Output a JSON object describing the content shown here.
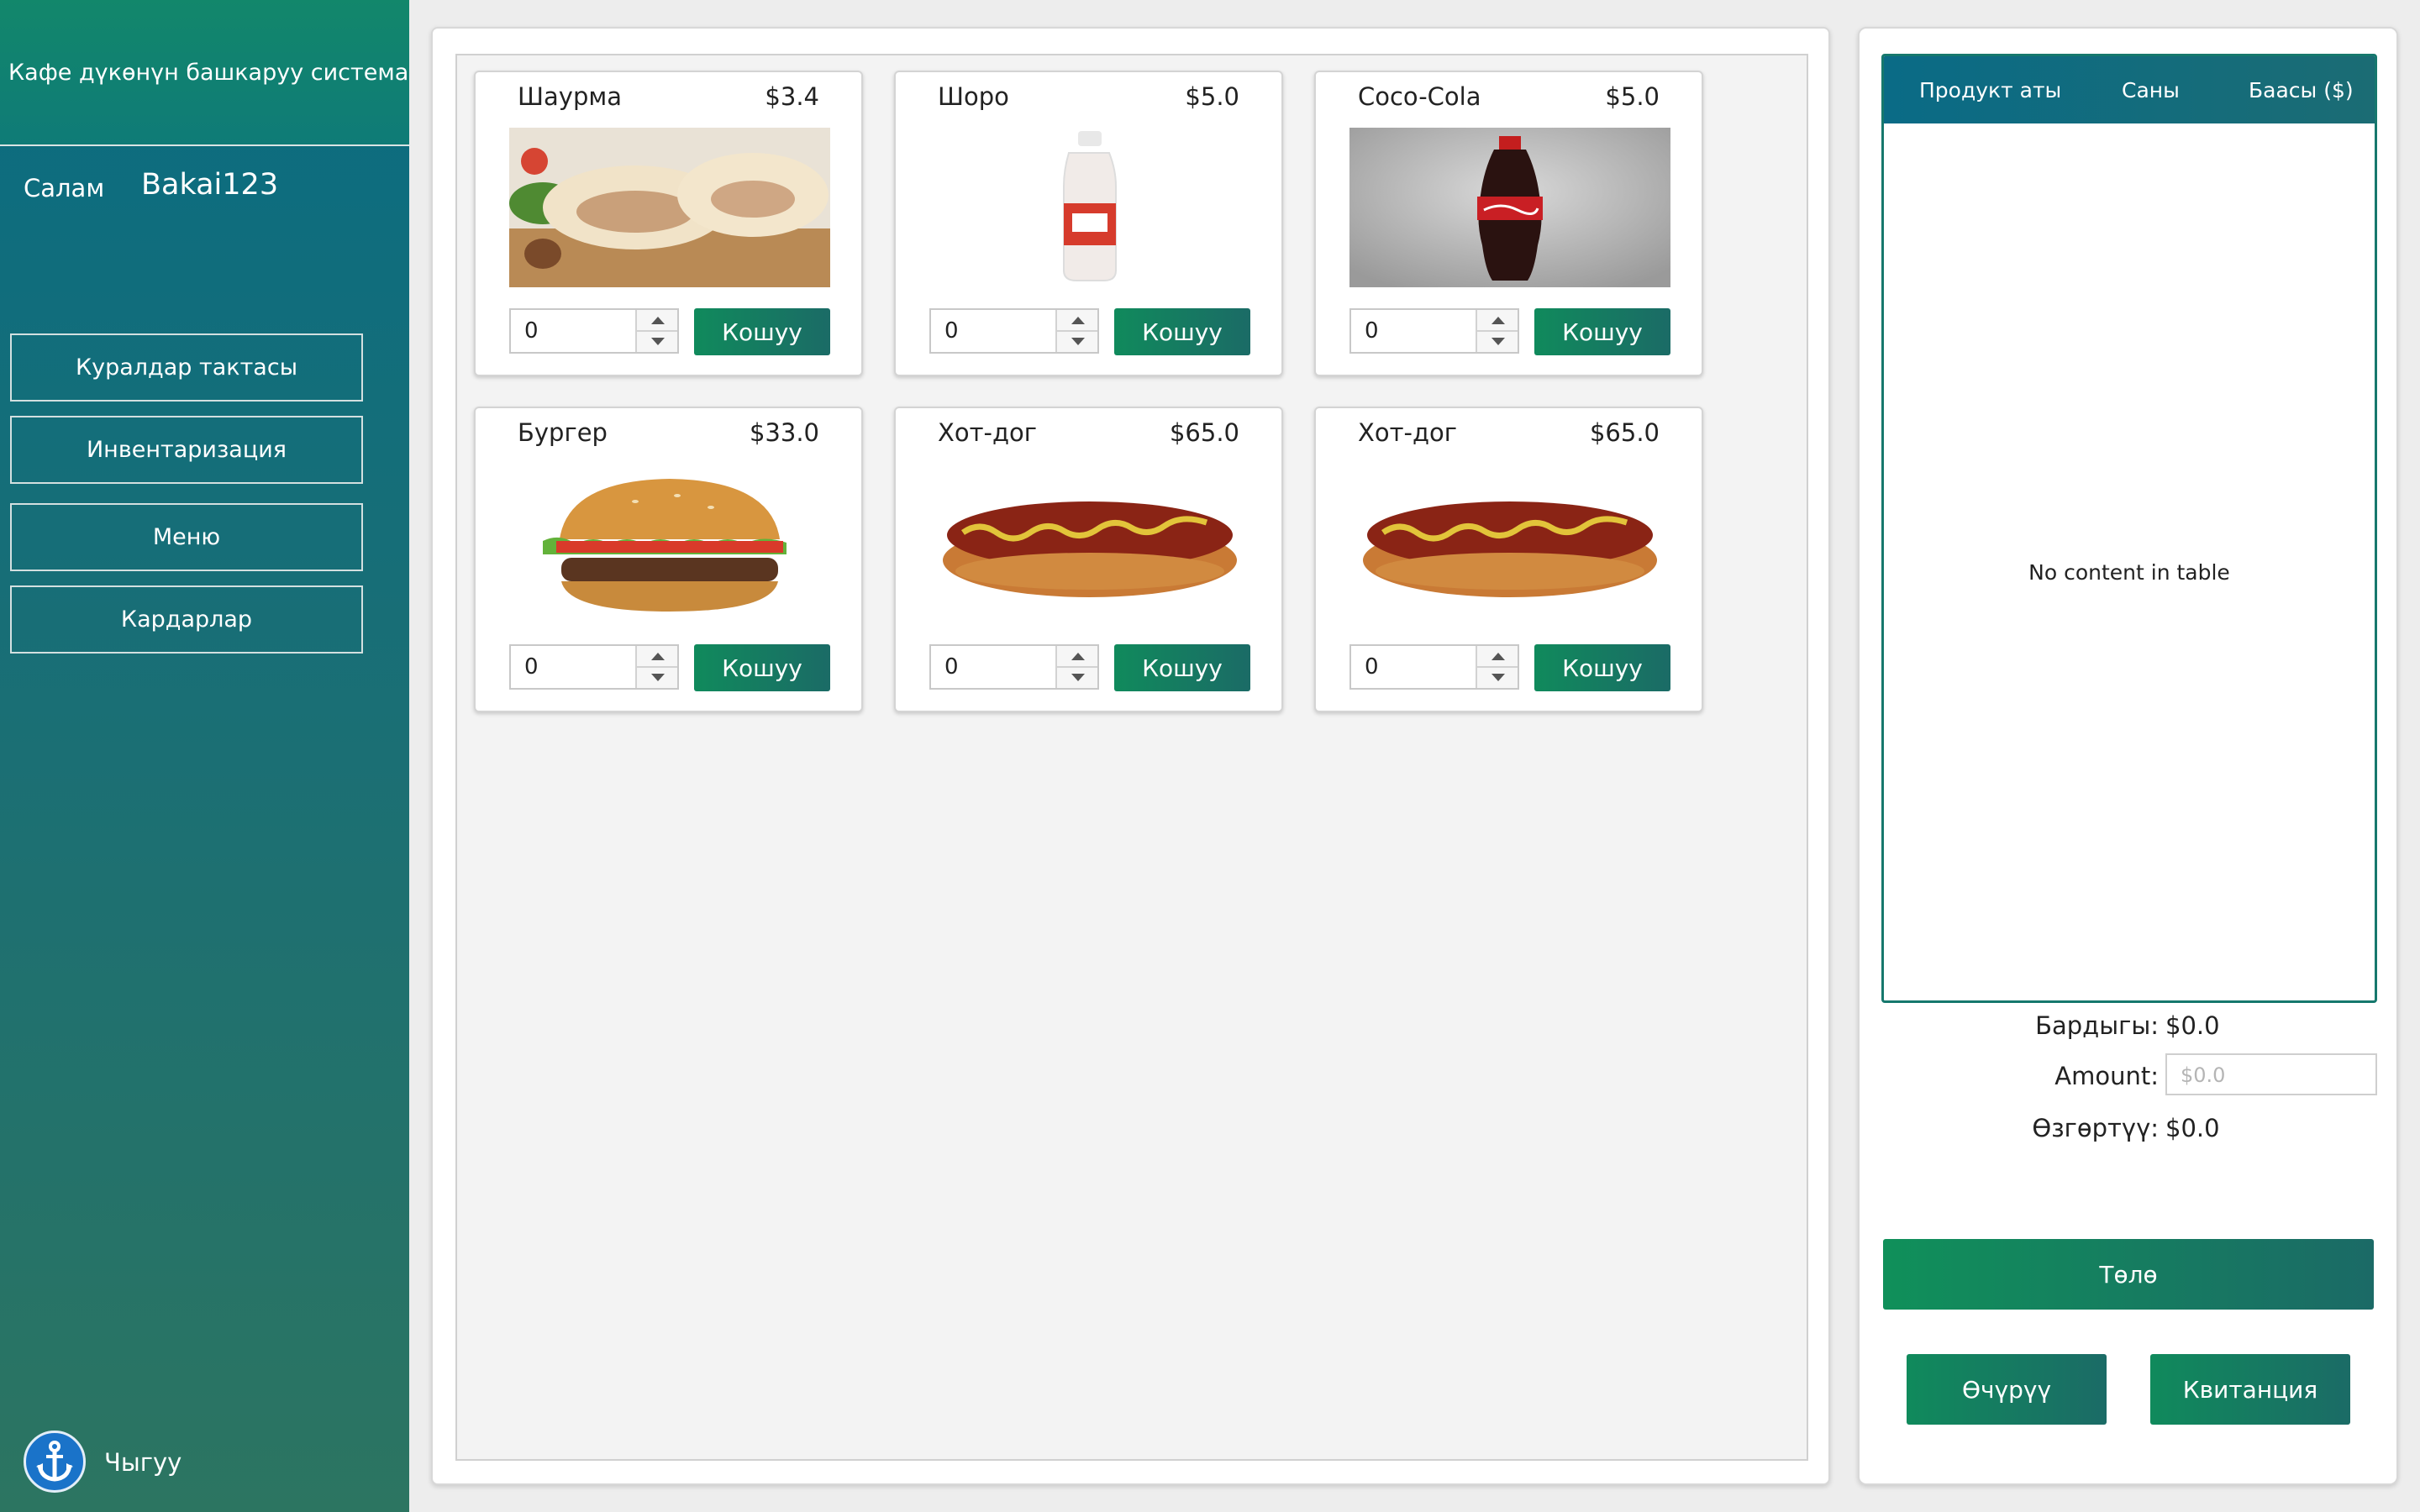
{
  "app": {
    "title": "Кафе дүкөнүн башкаруу системасы"
  },
  "user": {
    "greeting": "Салам",
    "name": "Bakai123"
  },
  "nav": [
    {
      "label": "Куралдар тактасы"
    },
    {
      "label": "Инвентаризация"
    },
    {
      "label": "Меню"
    },
    {
      "label": "Кардарлар"
    }
  ],
  "logout": {
    "label": "Чыгуу",
    "icon": "anchor-icon"
  },
  "menu_items": [
    {
      "name": "Шаурма",
      "price": "$3.4",
      "qty": "0",
      "add_label": "Кошуу",
      "image": "shawarma"
    },
    {
      "name": "Шоро",
      "price": "$5.0",
      "qty": "0",
      "add_label": "Кошуу",
      "image": "shoro-bottle"
    },
    {
      "name": "Coco-Cola",
      "price": "$5.0",
      "qty": "0",
      "add_label": "Кошуу",
      "image": "cola-bottle"
    },
    {
      "name": "Бургер",
      "price": "$33.0",
      "qty": "0",
      "add_label": "Кошуу",
      "image": "burger"
    },
    {
      "name": "Хот-дог",
      "price": "$65.0",
      "qty": "0",
      "add_label": "Кошуу",
      "image": "hotdog"
    },
    {
      "name": "Хот-дог",
      "price": "$65.0",
      "qty": "0",
      "add_label": "Кошуу",
      "image": "hotdog"
    }
  ],
  "order": {
    "columns": [
      "Продукт аты",
      "Саны",
      "Баасы ($)"
    ],
    "empty_text": "No content in table",
    "total_label": "Бардыгы:",
    "total_value": "$0.0",
    "amount_label": "Amount:",
    "amount_placeholder": "$0.0",
    "change_label": "Өзгөртүү:",
    "change_value": "$0.0",
    "pay_label": "Төлө",
    "delete_label": "Өчүрүү",
    "receipt_label": "Квитанция"
  },
  "colors": {
    "accent": "#108a5c",
    "teal": "#0a6c81"
  }
}
